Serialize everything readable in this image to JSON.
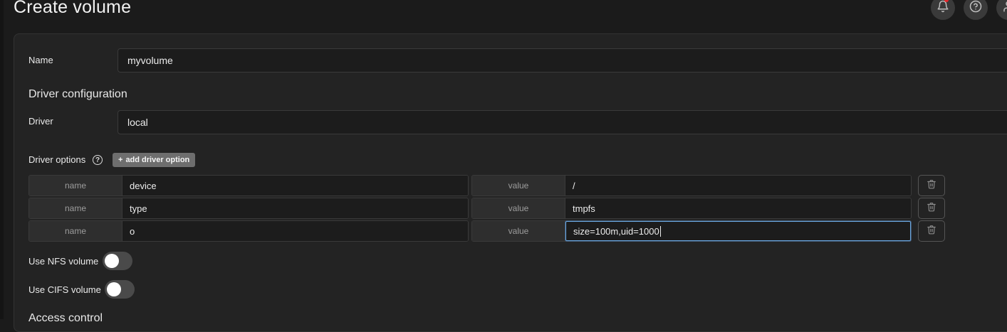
{
  "page": {
    "title": "Create volume"
  },
  "header": {
    "icons": [
      "bell-icon",
      "help-circle-icon",
      "user-icon"
    ],
    "notification_dot_color": "#e5262b"
  },
  "form": {
    "name": {
      "label": "Name",
      "value": "myvolume"
    },
    "driver_section": {
      "title": "Driver configuration"
    },
    "driver": {
      "label": "Driver",
      "value": "local"
    },
    "driver_options": {
      "label": "Driver options",
      "add_button_label": "add driver option",
      "rows": [
        {
          "name_addon": "name",
          "name": "device",
          "value_addon": "value",
          "value": "/"
        },
        {
          "name_addon": "name",
          "name": "type",
          "value_addon": "value",
          "value": "tmpfs"
        },
        {
          "name_addon": "name",
          "name": "o",
          "value_addon": "value",
          "value": "size=100m,uid=1000"
        }
      ]
    },
    "nfs": {
      "label": "Use NFS volume",
      "enabled": false
    },
    "cifs": {
      "label": "Use CIFS volume",
      "enabled": false
    },
    "access_control": {
      "title": "Access control"
    }
  }
}
